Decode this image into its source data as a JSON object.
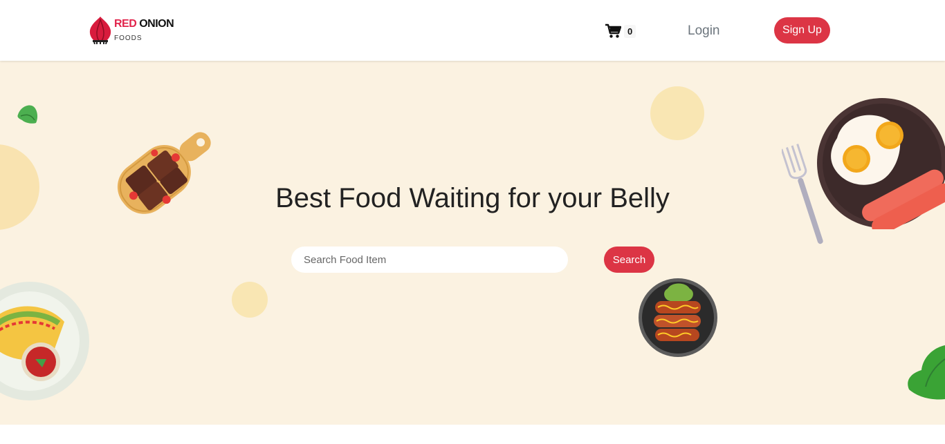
{
  "brand": {
    "name_part1": "RED",
    "name_part2": "ONION",
    "subtitle": "FOODS"
  },
  "nav": {
    "cart_count": "0",
    "login_label": "Login",
    "signup_label": "Sign Up"
  },
  "hero": {
    "title": "Best Food Waiting for your Belly",
    "search_placeholder": "Search Food Item",
    "search_button": "Search"
  },
  "colors": {
    "accent": "#dc3545",
    "hero_bg": "#fbf2e1",
    "brand_red": "#e1244b"
  },
  "icons": {
    "cart": "shopping-cart-icon",
    "logo": "red-onion-icon"
  }
}
